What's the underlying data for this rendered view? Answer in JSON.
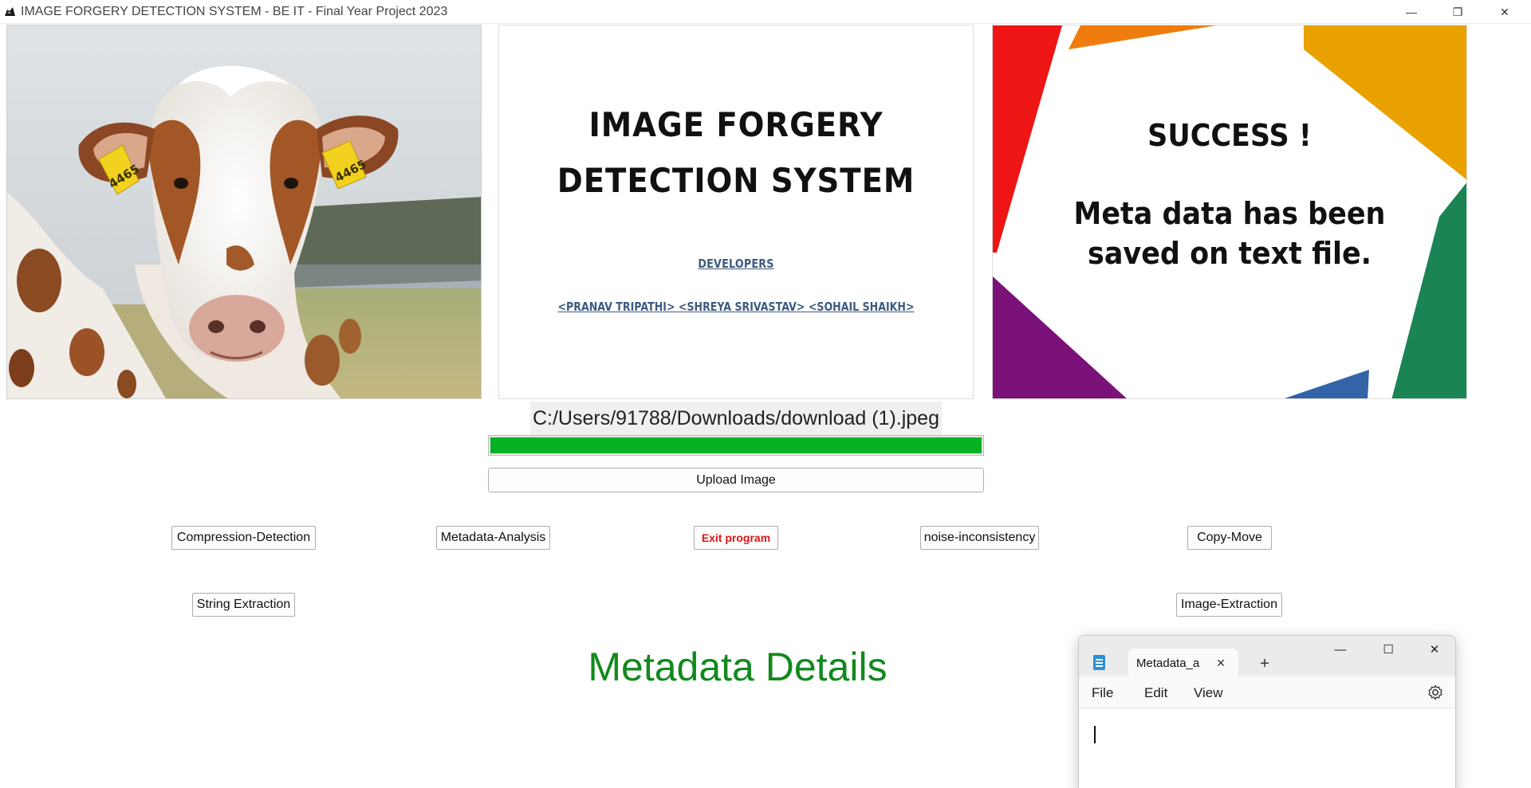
{
  "window": {
    "title": "IMAGE FORGERY DETECTION SYSTEM - BE IT - Final Year Project 2023",
    "minimize_glyph": "—",
    "restore_glyph": "❐",
    "close_glyph": "✕"
  },
  "panels": {
    "title_poster": {
      "line1": "IMAGE FORGERY",
      "line2": "DETECTION SYSTEM",
      "developers_heading": "DEVELOPERS",
      "developers_names": "<PRANAV TRIPATHI> <SHREYA SRIVASTAV> <SOHAIL SHAIKH>"
    },
    "success_poster": {
      "headline": "SUCCESS !",
      "message_line1": "Meta data has been",
      "message_line2": "saved on text file."
    },
    "photo": {
      "ear_tag_left": "4465",
      "ear_tag_right": "4465"
    }
  },
  "file_path": "C:/Users/91788/Downloads/download (1).jpeg",
  "progress_percent": 100,
  "buttons": {
    "upload": "Upload Image",
    "compression_detection": "Compression-Detection",
    "metadata_analysis": "Metadata-Analysis",
    "exit_program": "Exit program",
    "noise_inconsistency": "noise-inconsistency",
    "copy_move": "Copy-Move",
    "string_extraction": "String Extraction",
    "image_extraction": "Image-Extraction"
  },
  "metadata_heading": "Metadata Details",
  "notepad": {
    "tab_label": "Metadata_a",
    "tab_close_glyph": "✕",
    "new_tab_glyph": "+",
    "minimize_glyph": "—",
    "maximize_glyph": "☐",
    "close_glyph": "✕",
    "menu": [
      "File",
      "Edit",
      "View"
    ]
  },
  "colors": {
    "progress_green": "#06b025",
    "heading_green": "#12891e",
    "exit_red": "#e11414",
    "developer_blue": "#3d5a80"
  }
}
